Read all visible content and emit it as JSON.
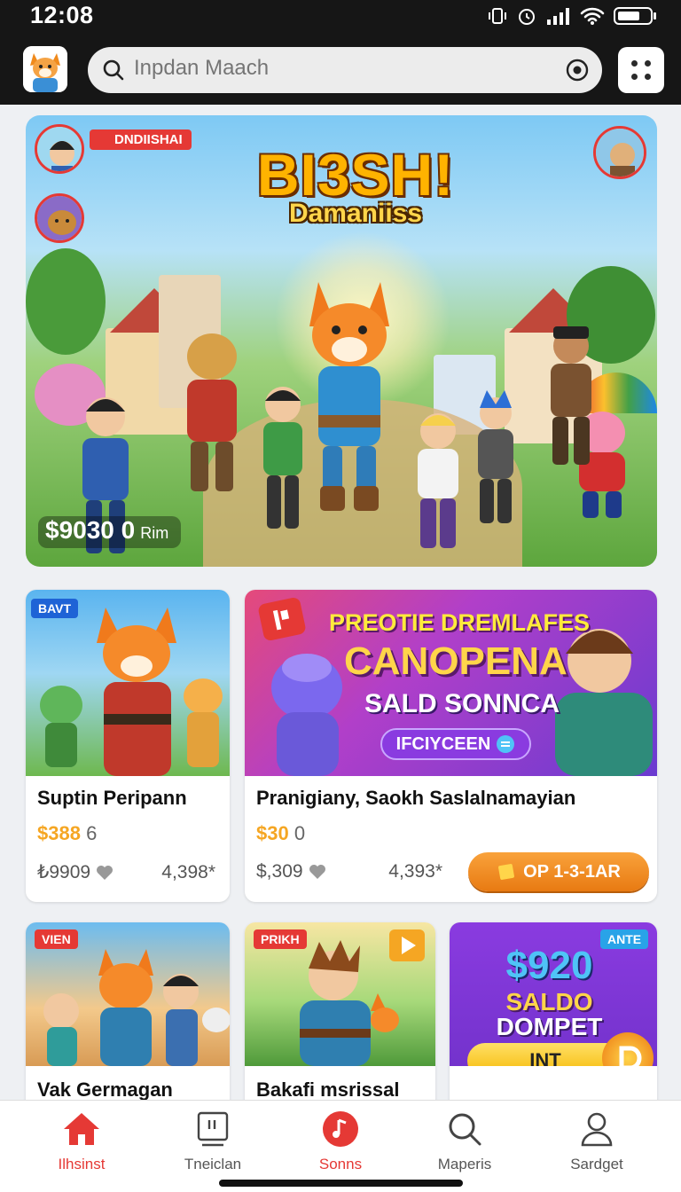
{
  "status_bar": {
    "time": "12:08"
  },
  "header": {
    "search_placeholder": "Inpdan Maach"
  },
  "hero": {
    "tag": "DNDIISHAI",
    "title_line1": "BI3SH!",
    "title_line2": "Damaniiss",
    "price": "$9030 0",
    "price_unit": "Rim"
  },
  "cards": [
    {
      "badge": "BAVT",
      "title": "Suptin Peripann",
      "price_gold": "$388",
      "price_grey": "6",
      "likes": "₺9909",
      "count": "4,398*"
    },
    {
      "badge_icon": "play-card-icon",
      "banner_line1": "PREOTIE DREMLAFES",
      "banner_line2": "CANOPENA",
      "banner_line3": "SALD SONNCA",
      "banner_pill": "IFCIYCEEN",
      "title": "Pranigiany, Saokh Saslalnamayian",
      "price_gold": "$30",
      "price_grey": "0",
      "likes": "$,309",
      "count": "4,393*",
      "cta": "OP 1-3-1AR"
    },
    {
      "badge": "VIEN",
      "title": "Vak Germagan"
    },
    {
      "badge": "PRIKH",
      "title": "Bakafi msrissal"
    },
    {
      "badge": "ANTE",
      "line1": "$920",
      "line2": "SALDO",
      "line3": "DOMPET",
      "button": "INT"
    }
  ],
  "bottom_nav": [
    {
      "label": "Ilhsinst",
      "icon": "home-icon",
      "active": true
    },
    {
      "label": "Tneiclan",
      "icon": "tablet-icon",
      "active": false
    },
    {
      "label": "Sonns",
      "icon": "music-icon",
      "active": true
    },
    {
      "label": "Maperis",
      "icon": "search-icon",
      "active": false
    },
    {
      "label": "Sardget",
      "icon": "profile-icon",
      "active": false
    }
  ],
  "colors": {
    "accent": "#e53935",
    "gold": "#f5a623",
    "cta": "#f08a1c",
    "purple": "#7b3fc4"
  }
}
